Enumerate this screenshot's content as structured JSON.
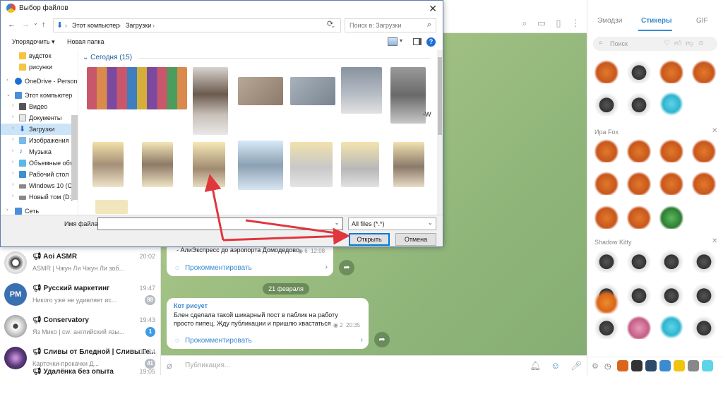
{
  "dialog": {
    "title": "Выбор файлов",
    "nav": {
      "back": "←",
      "forward": "→",
      "up_history": "⌄",
      "up": "↑"
    },
    "breadcrumb": [
      "Этот компьютер",
      "Загрузки"
    ],
    "search_placeholder": "Поиск в: Загрузки",
    "toolbar": {
      "organize": "Упорядочить ▾",
      "new_folder": "Новая папка"
    },
    "tree": [
      {
        "label": "вудсток",
        "kind": "folder"
      },
      {
        "label": "рисунки",
        "kind": "folder"
      },
      {
        "label": "OneDrive - Person",
        "kind": "cloud"
      },
      {
        "label": "Этот компьютер",
        "kind": "pc"
      },
      {
        "label": "Видео",
        "kind": "video"
      },
      {
        "label": "Документы",
        "kind": "docs"
      },
      {
        "label": "Загрузки",
        "kind": "downloads",
        "selected": true
      },
      {
        "label": "Изображения",
        "kind": "images"
      },
      {
        "label": "Музыка",
        "kind": "music"
      },
      {
        "label": "Объемные объе",
        "kind": "3d"
      },
      {
        "label": "Рабочий стол",
        "kind": "desktop"
      },
      {
        "label": "Windows 10 (C:)",
        "kind": "drive"
      },
      {
        "label": "Новый том (D:)",
        "kind": "drive"
      },
      {
        "label": "Сеть",
        "kind": "network"
      }
    ],
    "group_header": "Сегодня (15)",
    "file_name_label": "Имя файла:",
    "file_name_value": "",
    "file_type": "All files (*.*)",
    "open_label": "Открыть",
    "cancel_label": "Отмена",
    "close_glyph": "✕",
    "help_glyph": "?",
    "thumb_caption_tail": "-W"
  },
  "telegram": {
    "chats": [
      {
        "name": "Aoi ASMR",
        "time": "20:02",
        "preview": "ASMR | Чжун Ли  Чжун Ли зоб..."
      },
      {
        "name": "Русский маркетинг",
        "time": "19:47",
        "preview": "Никого уже не удивляет ис...",
        "badge": "88",
        "avatar_text": "PM"
      },
      {
        "name": "Conservatory",
        "time": "19:43",
        "preview": "Яз Мико |  cw: английский язы...",
        "badge": "1",
        "badge_blue": true
      },
      {
        "name": "Сливы от Бледной | Сливы Ге...",
        "time": "19:24",
        "preview": "Карточки-прокачки Д...",
        "badge": "41"
      },
      {
        "name": "Удалёнка без опыта",
        "time": "19:05",
        "preview": ""
      }
    ],
    "messages": [
      {
        "text": "- АлиЭкспресс до аэропорта Домодедово",
        "views": "6",
        "time": "12:08",
        "comment": "Прокомментировать"
      },
      {
        "author": "Кот рисует",
        "text": "Блен сделала такой шикарный пост в паблик на работу просто пипец. Жду публикации и пришлю хвастаться",
        "views": "2",
        "time": "20:35",
        "comment": "Прокомментировать"
      }
    ],
    "date_pill": "21 февраля",
    "composer_placeholder": "Публикация...",
    "sticker_tabs": [
      "Эмодзи",
      "Стикеры",
      "GIF"
    ],
    "sticker_search": "Поиск",
    "sticker_sets": [
      "Ира Fox",
      "Shadow Kitty"
    ]
  },
  "colors": {
    "accent": "#0078d7",
    "telegram_blue": "#3a8bd0",
    "arrow": "#e0373f"
  }
}
